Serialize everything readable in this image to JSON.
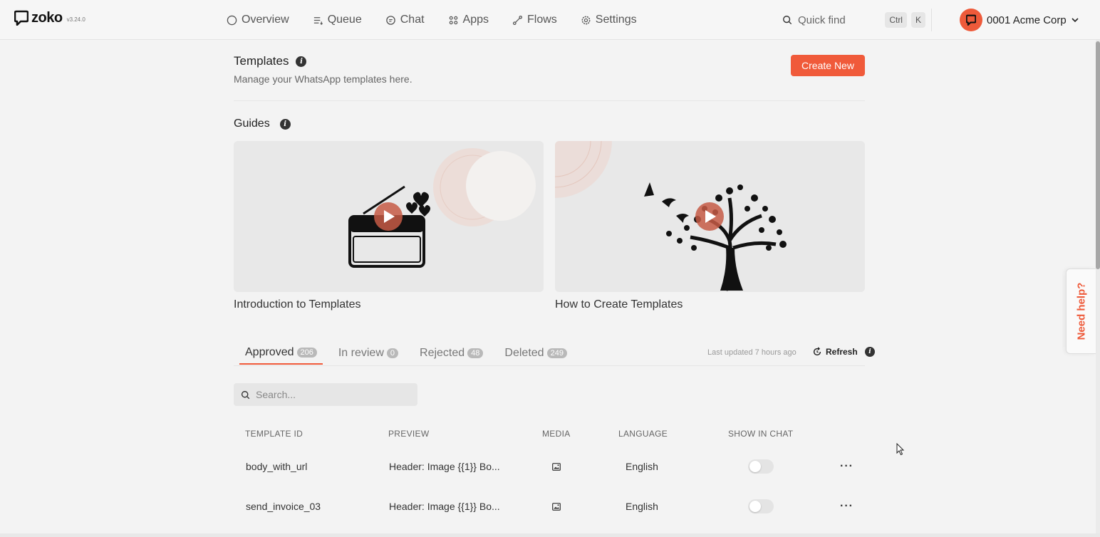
{
  "app": {
    "name": "zoko",
    "version": "v3.24.0"
  },
  "nav": [
    {
      "label": "Overview",
      "icon": "circle-icon"
    },
    {
      "label": "Queue",
      "icon": "queue-icon"
    },
    {
      "label": "Chat",
      "icon": "chat-icon"
    },
    {
      "label": "Apps",
      "icon": "apps-icon"
    },
    {
      "label": "Flows",
      "icon": "flows-icon"
    },
    {
      "label": "Settings",
      "icon": "gear-icon"
    }
  ],
  "quickfind": {
    "label": "Quick find",
    "keys": [
      "Ctrl",
      "K"
    ]
  },
  "account": {
    "name": "0001 Acme Corp"
  },
  "page": {
    "title": "Templates",
    "subtitle": "Manage your WhatsApp templates here.",
    "create_label": "Create New"
  },
  "guides": {
    "title": "Guides",
    "items": [
      {
        "label": "Introduction to Templates"
      },
      {
        "label": "How to Create Templates"
      }
    ]
  },
  "tabs": [
    {
      "label": "Approved",
      "count": "206",
      "active": true
    },
    {
      "label": "In review",
      "count": "0"
    },
    {
      "label": "Rejected",
      "count": "48"
    },
    {
      "label": "Deleted",
      "count": "249"
    }
  ],
  "status": {
    "last_updated": "Last updated 7 hours ago",
    "refresh_label": "Refresh"
  },
  "search": {
    "placeholder": "Search..."
  },
  "table": {
    "headers": [
      "TEMPLATE ID",
      "PREVIEW",
      "MEDIA",
      "LANGUAGE",
      "SHOW IN CHAT"
    ],
    "rows": [
      {
        "id": "body_with_url",
        "preview": "Header: Image {{1}} Bo...",
        "media": "image-icon",
        "language": "English",
        "show_in_chat": false
      },
      {
        "id": "send_invoice_03",
        "preview": "Header: Image {{1}} Bo...",
        "media": "image-icon",
        "language": "English",
        "show_in_chat": false
      }
    ]
  },
  "help": {
    "label": "Need help?"
  },
  "colors": {
    "accent": "#f05a3a",
    "background": "#f3f3f3"
  }
}
